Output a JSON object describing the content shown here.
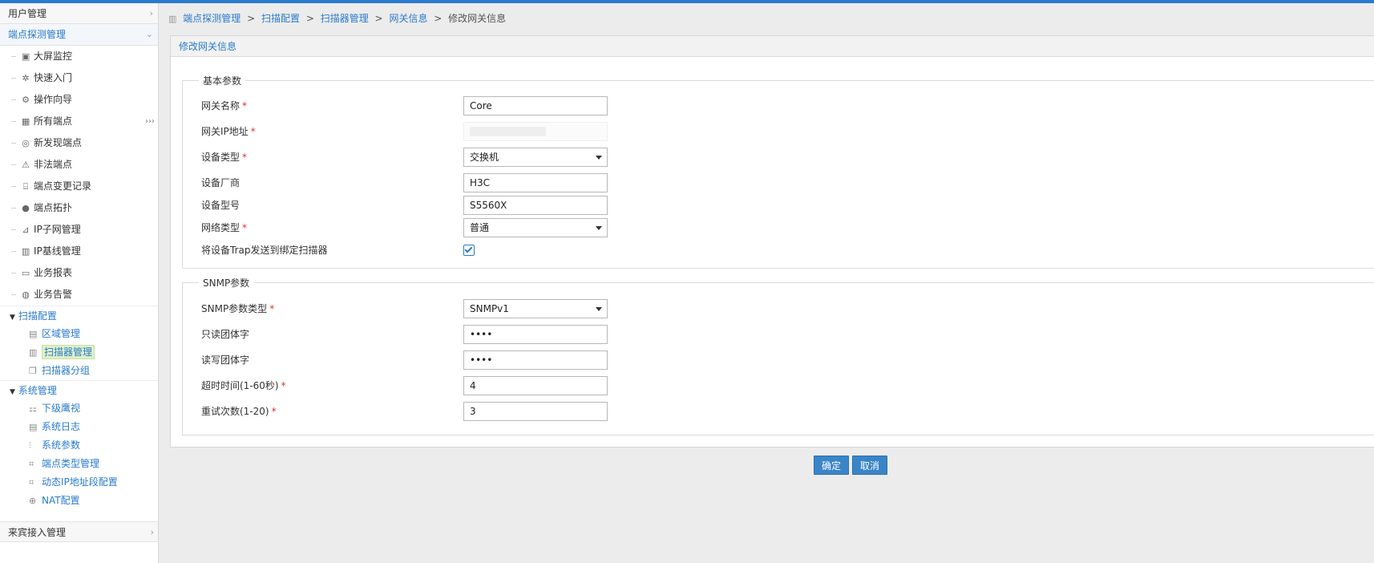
{
  "sidebar": {
    "sections": {
      "user_mgmt": "用户管理",
      "endpoint_mgmt": "端点探测管理",
      "guest_access": "来宾接入管理"
    },
    "tree_items": [
      {
        "icon": "monitor-icon",
        "label": "大屏监控"
      },
      {
        "icon": "gear-icon",
        "label": "快速入门"
      },
      {
        "icon": "wizard-icon",
        "label": "操作向导"
      },
      {
        "icon": "grid-icon",
        "label": "所有端点"
      },
      {
        "icon": "radar-icon",
        "label": "新发现端点"
      },
      {
        "icon": "warning-icon",
        "label": "非法端点"
      },
      {
        "icon": "history-icon",
        "label": "端点变更记录"
      },
      {
        "icon": "topology-icon",
        "label": "端点拓扑"
      },
      {
        "icon": "subnet-icon",
        "label": "IP子网管理"
      },
      {
        "icon": "baseline-icon",
        "label": "IP基线管理"
      },
      {
        "icon": "report-icon",
        "label": "业务报表"
      },
      {
        "icon": "alarm-icon",
        "label": "业务告警"
      }
    ],
    "groups": {
      "scan_config": {
        "label": "扫描配置",
        "items": [
          {
            "icon": "region-icon",
            "label": "区域管理"
          },
          {
            "icon": "scanner-icon",
            "label": "扫描器管理"
          },
          {
            "icon": "group-icon",
            "label": "扫描器分组"
          }
        ]
      },
      "system_mgmt": {
        "label": "系统管理",
        "items": [
          {
            "icon": "sub-view-icon",
            "label": "下级鹰视"
          },
          {
            "icon": "log-icon",
            "label": "系统日志"
          },
          {
            "icon": "params-icon",
            "label": "系统参数"
          },
          {
            "icon": "type-icon",
            "label": "端点类型管理"
          },
          {
            "icon": "dynamic-ip-icon",
            "label": "动态IP地址段配置"
          },
          {
            "icon": "nat-icon",
            "label": "NAT配置"
          }
        ]
      }
    }
  },
  "breadcrumb": {
    "items": [
      "端点探测管理",
      "扫描配置",
      "扫描器管理",
      "网关信息"
    ],
    "current": "修改网关信息",
    "separator": ">"
  },
  "panel": {
    "title": "修改网关信息",
    "basic_legend": "基本参数",
    "snmp_legend": "SNMP参数"
  },
  "form": {
    "gateway_name": {
      "label": "网关名称",
      "value": "Core",
      "required": "*"
    },
    "gateway_ip": {
      "label": "网关IP地址",
      "required": "*"
    },
    "device_type": {
      "label": "设备类型",
      "value": "交换机",
      "required": "*"
    },
    "vendor": {
      "label": "设备厂商",
      "value": "H3C"
    },
    "model": {
      "label": "设备型号",
      "value": "S5560X"
    },
    "network_type": {
      "label": "网络类型",
      "value": "普通",
      "required": "*"
    },
    "trap": {
      "label": "将设备Trap发送到绑定扫描器",
      "checked": true
    },
    "snmp_type": {
      "label": "SNMP参数类型",
      "value": "SNMPv1",
      "required": "*"
    },
    "ro_community": {
      "label": "只读团体字",
      "value": "••••"
    },
    "rw_community": {
      "label": "读写团体字",
      "value": "••••"
    },
    "timeout": {
      "label": "超时时间(1-60秒)",
      "value": "4",
      "required": "*"
    },
    "retries": {
      "label": "重试次数(1-20)",
      "value": "3",
      "required": "*"
    }
  },
  "buttons": {
    "ok": "确定",
    "cancel": "取消"
  },
  "colors": {
    "accent": "#2a7bcb",
    "required": "#d9322a",
    "button": "#3a85c8",
    "selected_bg": "#dff0c8"
  }
}
